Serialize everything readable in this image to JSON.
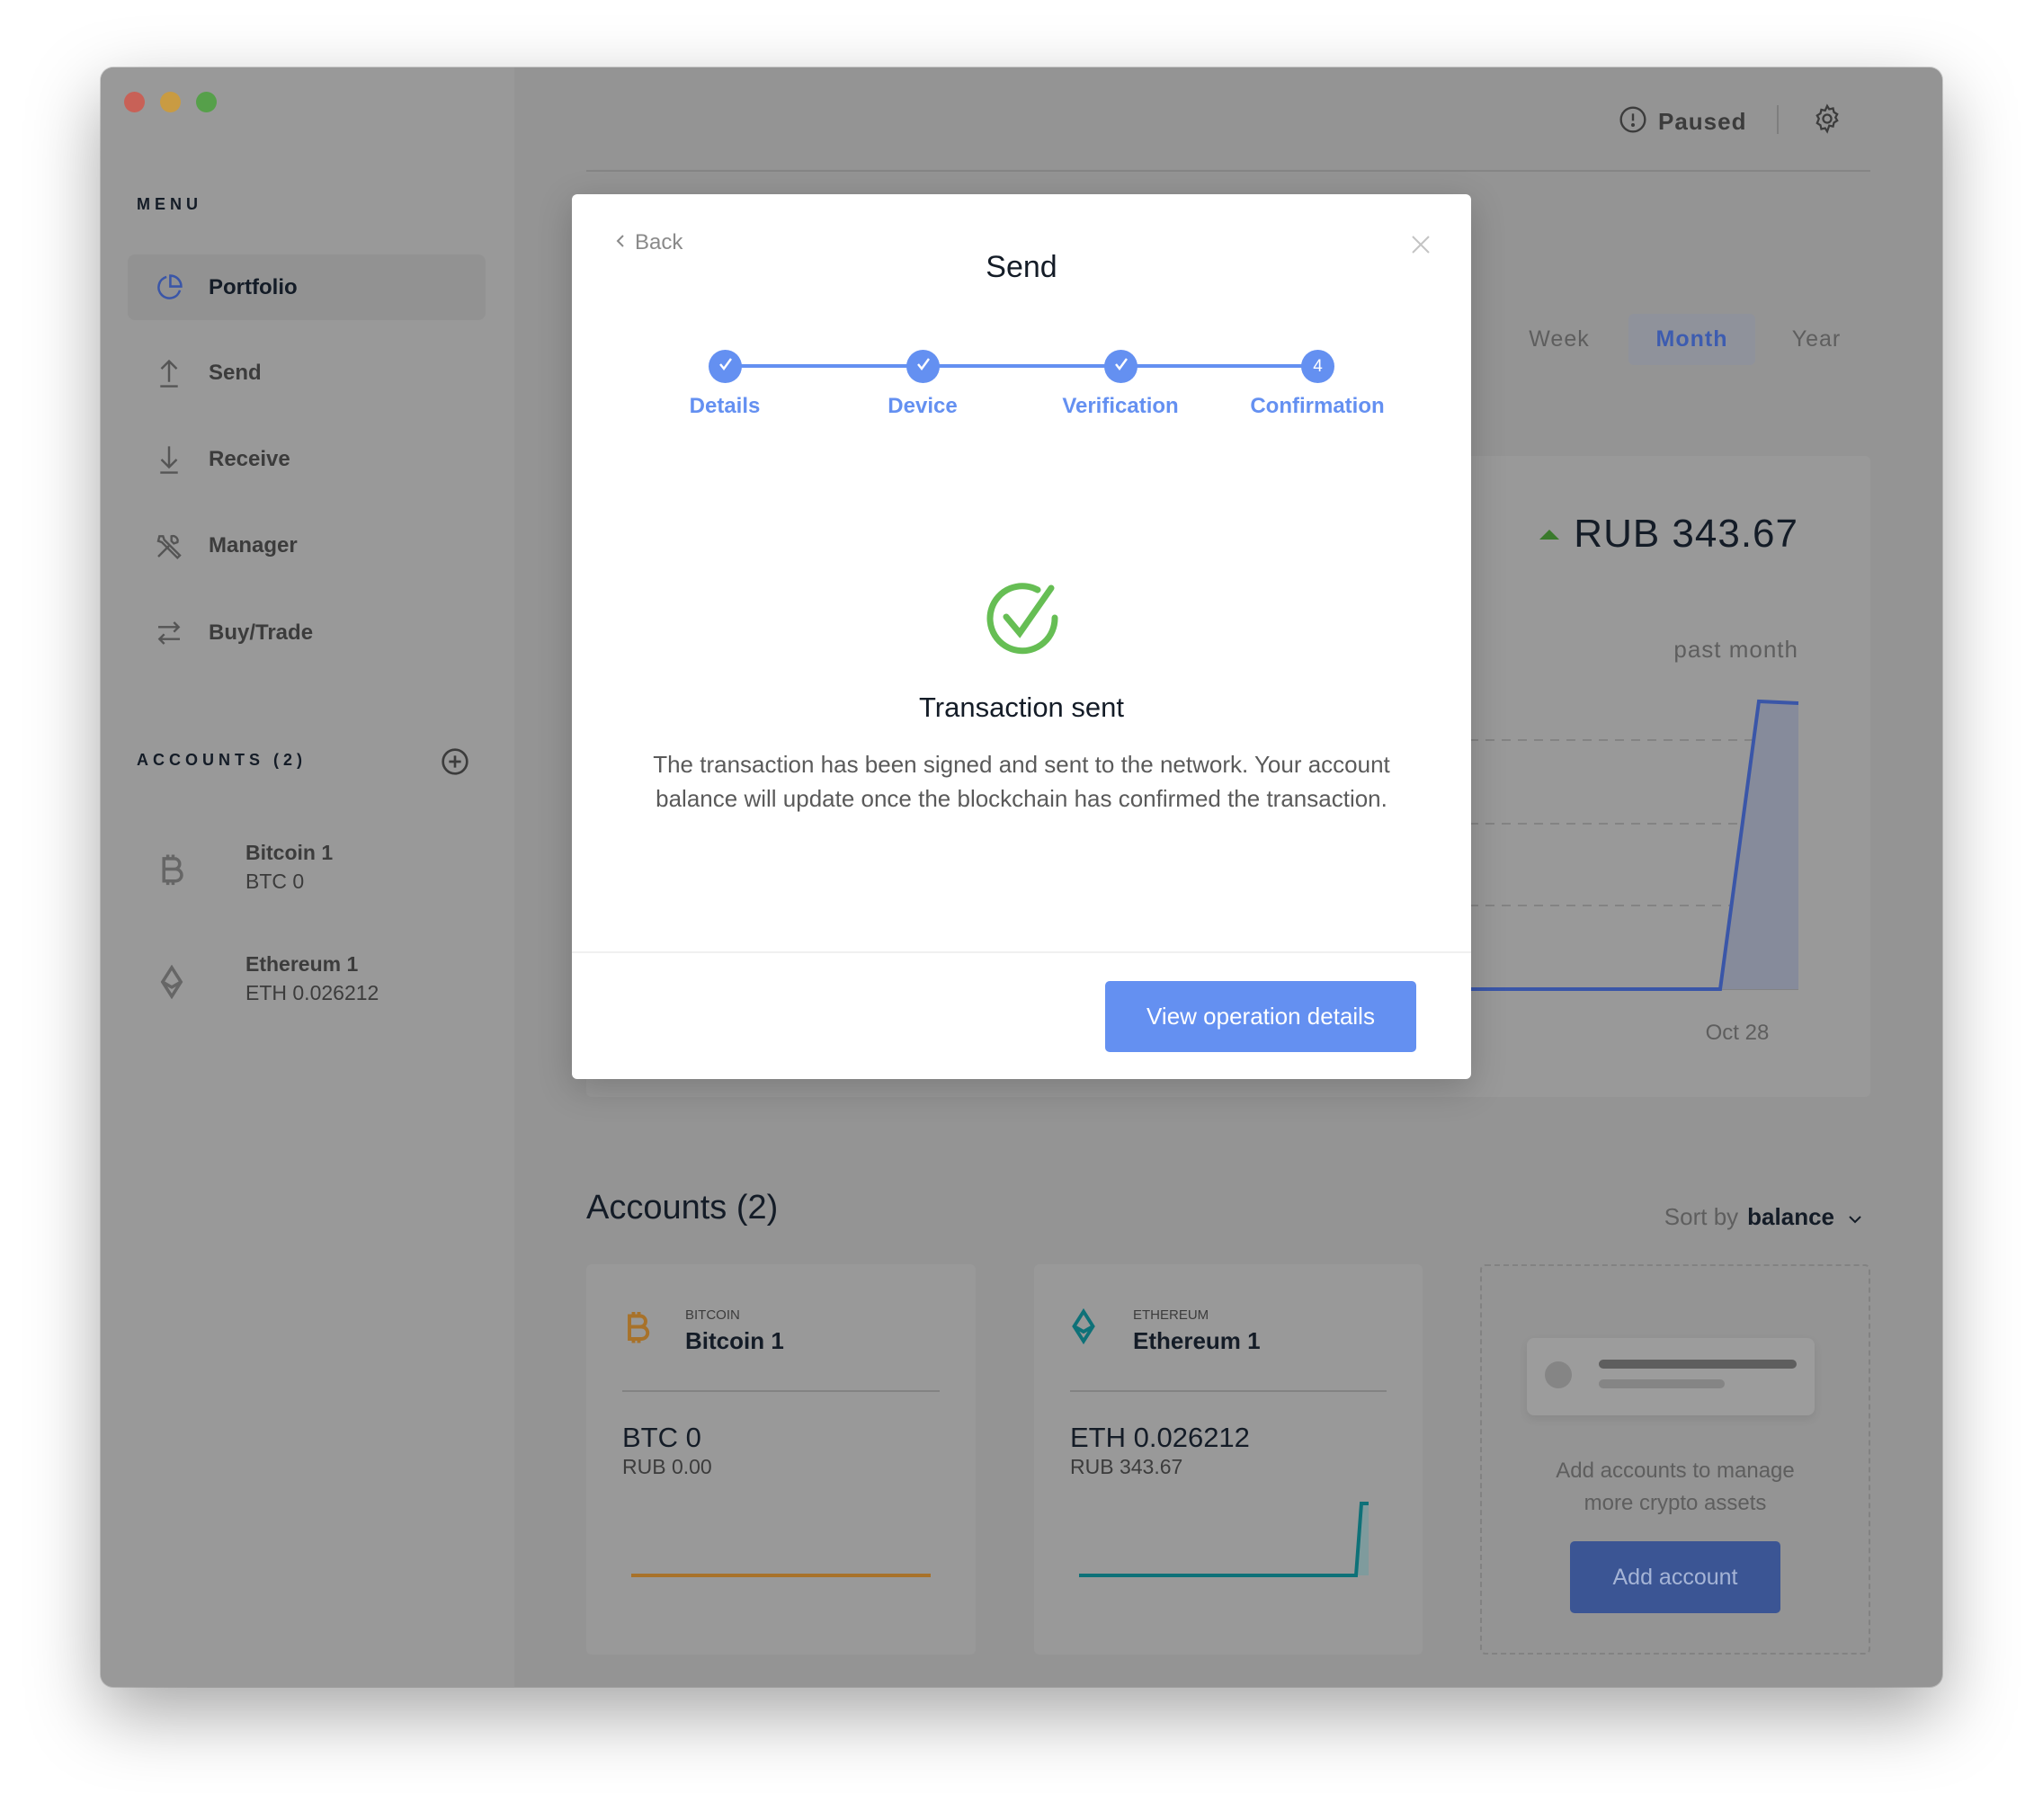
{
  "window": {
    "traffic_lights": {
      "close": "#ee6a5f",
      "minimize": "#f5bd4f",
      "maximize": "#61c454"
    }
  },
  "sidebar": {
    "menu_label": "MENU",
    "items": [
      {
        "label": "Portfolio",
        "icon": "pie-chart-icon",
        "active": true
      },
      {
        "label": "Send",
        "icon": "upload-arrow-icon"
      },
      {
        "label": "Receive",
        "icon": "download-arrow-icon"
      },
      {
        "label": "Manager",
        "icon": "tools-icon"
      },
      {
        "label": "Buy/Trade",
        "icon": "swap-arrows-icon"
      }
    ],
    "accounts_label": "ACCOUNTS (2)",
    "accounts": [
      {
        "name": "Bitcoin 1",
        "balance": "BTC 0",
        "icon": "bitcoin-icon"
      },
      {
        "name": "Ethereum 1",
        "balance": "ETH 0.026212",
        "icon": "ethereum-icon"
      }
    ]
  },
  "topbar": {
    "status": "Paused",
    "status_icon": "alert-circle-icon",
    "settings_icon": "gear-icon"
  },
  "portfolio": {
    "periods": [
      "Week",
      "Month",
      "Year"
    ],
    "selected_period": "Month",
    "balance_change": "RUB 343.67",
    "balance_change_caption": "past month",
    "chart_x_label": "Oct 28"
  },
  "accounts_section": {
    "title": "Accounts (2)",
    "sort_label": "Sort by",
    "sort_value": "balance",
    "cards": [
      {
        "type": "BITCOIN",
        "name": "Bitcoin 1",
        "amount": "BTC 0",
        "fiat": "RUB 0.00",
        "color": "#a8722a"
      },
      {
        "type": "ETHEREUM",
        "name": "Ethereum 1",
        "amount": "ETH 0.026212",
        "fiat": "RUB 343.67",
        "color": "#0e7178"
      }
    ],
    "add_prompt_line1": "Add accounts to manage",
    "add_prompt_line2": "more crypto assets",
    "add_button": "Add account"
  },
  "modal": {
    "back_label": "Back",
    "title": "Send",
    "steps": [
      {
        "label": "Details",
        "done": true
      },
      {
        "label": "Device",
        "done": true
      },
      {
        "label": "Verification",
        "done": true
      },
      {
        "label": "Confirmation",
        "number": "4"
      }
    ],
    "result_title": "Transaction sent",
    "result_text": "The transaction has been signed and sent to the network. Your account balance will update once the blockchain has confirmed the transaction.",
    "primary_button": "View operation details",
    "accent": "#6490f1",
    "success": "#66be54"
  }
}
